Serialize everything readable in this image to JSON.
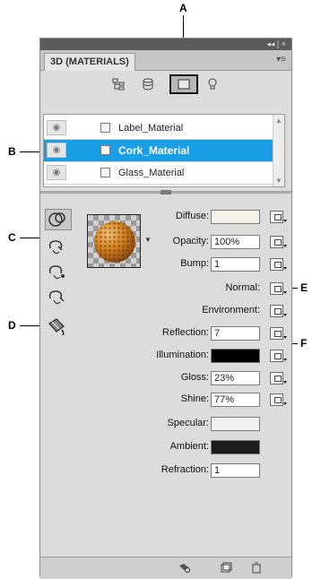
{
  "callouts": {
    "a": "A",
    "b": "B",
    "c": "C",
    "d": "D",
    "e": "E",
    "f": "F"
  },
  "panel": {
    "title": "3D (MATERIALS)",
    "window_controls": "◂◂ | ×",
    "menu_icon": "▾≡"
  },
  "filter_icons": [
    "scene-filter-icon",
    "mesh-filter-icon",
    "materials-filter-icon",
    "lights-filter-icon"
  ],
  "materials": [
    {
      "name": "Label_Material",
      "selected": false
    },
    {
      "name": "Cork_Material",
      "selected": true
    },
    {
      "name": "Glass_Material",
      "selected": false
    }
  ],
  "tools": [
    "material-rotate-tool-icon",
    "material-paint-bucket-icon",
    "material-drop-tool-icon",
    "material-select-tool-icon",
    "material-drop-bucket-icon"
  ],
  "properties": {
    "diffuse": {
      "label": "Diffuse:",
      "swatch": "#f4f2e8"
    },
    "opacity": {
      "label": "Opacity:",
      "value": "100%"
    },
    "bump": {
      "label": "Bump:",
      "value": "1"
    },
    "normal": {
      "label": "Normal:"
    },
    "environment": {
      "label": "Environment:"
    },
    "reflection": {
      "label": "Reflection:",
      "value": "7"
    },
    "illumination": {
      "label": "Illumination:",
      "swatch": "#000000"
    },
    "gloss": {
      "label": "Gloss:",
      "value": "23%"
    },
    "shine": {
      "label": "Shine:",
      "value": "77%"
    },
    "specular": {
      "label": "Specular:",
      "swatch": "#f0f0f0"
    },
    "ambient": {
      "label": "Ambient:",
      "swatch": "#1c1c1c"
    },
    "refraction": {
      "label": "Refraction:",
      "value": "1"
    }
  },
  "bottom_icons": [
    "render-settings-icon",
    "new-texture-icon",
    "delete-icon"
  ],
  "colors": {
    "selection": "#1a9fe6",
    "panel": "#dcdcdc"
  }
}
